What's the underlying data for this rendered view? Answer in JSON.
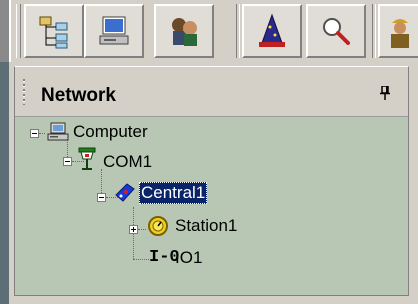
{
  "toolbar": {
    "buttons": [
      {
        "name": "network-tree-icon",
        "tooltip": ""
      },
      {
        "name": "computer-icon",
        "tooltip": ""
      },
      {
        "name": "users-icon",
        "tooltip": ""
      },
      {
        "name": "wizard-icon",
        "tooltip": ""
      },
      {
        "name": "search-icon",
        "tooltip": ""
      },
      {
        "name": "worker-icon",
        "tooltip": ""
      }
    ]
  },
  "panel": {
    "title": "Network",
    "pin_icon": "pin-icon"
  },
  "tree": {
    "nodes": [
      {
        "label": "Computer",
        "icon": "computer-icon",
        "expanded": true,
        "level": 0
      },
      {
        "label": "COM1",
        "icon": "com-port-icon",
        "expanded": true,
        "level": 1
      },
      {
        "label": "Central1",
        "icon": "central-icon",
        "expanded": true,
        "level": 2,
        "selected": true
      },
      {
        "label": "Station1",
        "icon": "station-icon",
        "expanded": false,
        "level": 3
      },
      {
        "label": "IO1",
        "icon": "io-icon",
        "icon_text": "I-0",
        "level": 3
      }
    ]
  },
  "colors": {
    "toolbar_bg": "#d4d0c8",
    "tree_bg": "#b8c7b3",
    "selection_bg": "#0a246a",
    "outer_bg": "#5e6e76"
  }
}
